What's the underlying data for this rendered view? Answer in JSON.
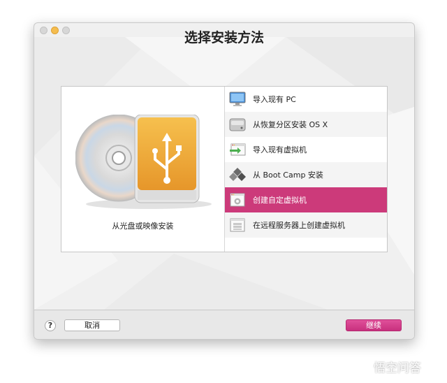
{
  "window": {
    "title": "选择安装方法"
  },
  "media": {
    "caption": "从光盘或映像安装"
  },
  "options": [
    {
      "label": "导入现有 PC",
      "icon": "monitor-import-icon"
    },
    {
      "label": "从恢复分区安装 OS X",
      "icon": "hard-drive-icon"
    },
    {
      "label": "导入现有虚拟机",
      "icon": "window-import-icon"
    },
    {
      "label": "从 Boot Camp 安装",
      "icon": "boot-camp-icon"
    },
    {
      "label": "创建自定虚拟机",
      "icon": "gear-window-icon",
      "selected": true
    },
    {
      "label": "在远程服务器上创建虚拟机",
      "icon": "server-window-icon"
    }
  ],
  "footer": {
    "help_label": "?",
    "cancel_label": "取消",
    "continue_label": "继续"
  },
  "watermark": {
    "text": "悟空问答"
  },
  "colors": {
    "accent": "#cc3a7a",
    "button_continue": "#d9408a"
  }
}
